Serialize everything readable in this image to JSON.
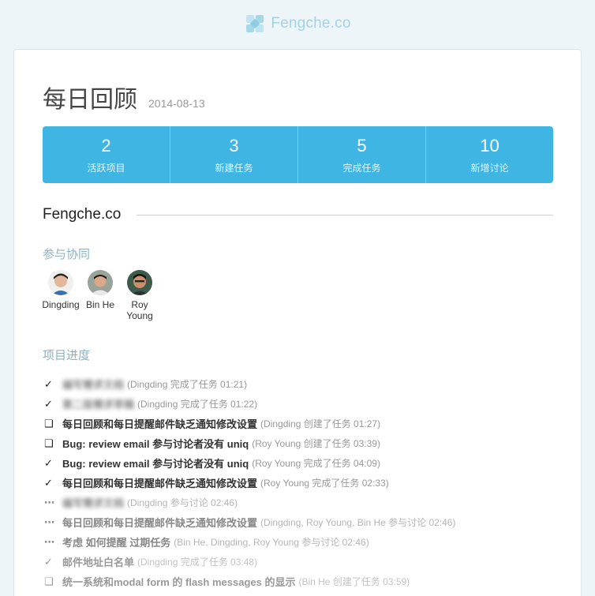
{
  "brand": {
    "name": "Fengche.co",
    "logo_icon": "pinwheel-icon"
  },
  "header": {
    "title": "每日回顾",
    "date": "2014-08-13"
  },
  "stats": [
    {
      "value": "2",
      "label": "活跃项目"
    },
    {
      "value": "3",
      "label": "新建任务"
    },
    {
      "value": "5",
      "label": "完成任务"
    },
    {
      "value": "10",
      "label": "新增讨论"
    }
  ],
  "project": {
    "name": "Fengche.co"
  },
  "collaboration": {
    "title": "参与协同",
    "members": [
      {
        "name": "Dingding"
      },
      {
        "name": "Bin He"
      },
      {
        "name": "Roy Young"
      }
    ]
  },
  "progress": {
    "title": "项目进度",
    "items": [
      {
        "mark": "✓",
        "task": "编写需求文档",
        "meta": "(Dingding 完成了任务 01:21)"
      },
      {
        "mark": "✓",
        "task": "第二版需求草稿",
        "meta": "(Dingding 完成了任务 01:22)"
      },
      {
        "mark": "❑",
        "task": "每日回顾和每日提醒邮件缺乏通知修改设置",
        "meta": "(Dingding 创建了任务 01:27)"
      },
      {
        "mark": "❑",
        "task": "Bug: review email 参与讨论者没有 uniq",
        "meta": "(Roy Young 创建了任务 03:39)"
      },
      {
        "mark": "✓",
        "task": "Bug: review email 参与讨论者没有 uniq",
        "meta": "(Roy Young 完成了任务 04:09)"
      },
      {
        "mark": "✓",
        "task": "每日回顾和每日提醒邮件缺乏通知修改设置",
        "meta": "(Roy Young 完成了任务 02:33)"
      },
      {
        "mark": "⋯",
        "task": "编写需求文档",
        "meta": "(Dingding 参与讨论 02:46)"
      },
      {
        "mark": "⋯",
        "task": "每日回顾和每日提醒邮件缺乏通知修改设置",
        "meta": "(Dingding, Roy Young, Bin He 参与讨论 02:46)"
      },
      {
        "mark": "⋯",
        "task": "考虑 如何提醒 过期任务",
        "meta": "(Bin He, Dingding, Roy Young 参与讨论 02:46)"
      },
      {
        "mark": "✓",
        "task": "邮件地址白名单",
        "meta": "(Dingding 完成了任务 03:48)"
      },
      {
        "mark": "❑",
        "task": "统一系统和modal form 的 flash messages 的显示",
        "meta": "(Bin He 创建了任务 03:59)"
      }
    ]
  }
}
